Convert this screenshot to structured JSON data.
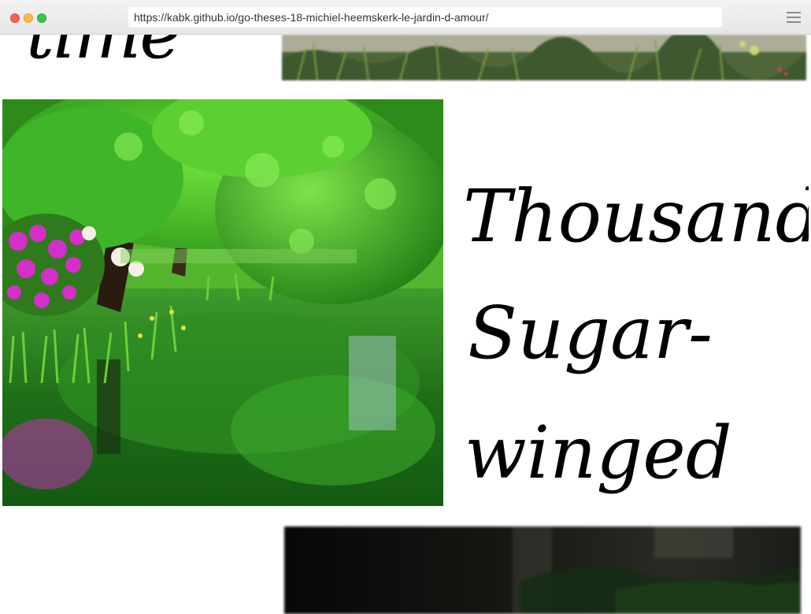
{
  "browser": {
    "url": "https://kabk.github.io/go-theses-18-michiel-heemskerk-le-jardin-d-amour/"
  },
  "page": {
    "top_word": "time",
    "words": [
      "Thousand",
      "Sugar-",
      "winged"
    ]
  },
  "colors": {
    "chrome_bg": "#e8e8e8",
    "text": "#000000",
    "page_bg": "#ffffff"
  },
  "icons": {
    "window_controls": [
      "close-dot",
      "minimize-dot",
      "maximize-dot"
    ],
    "menu": "hamburger-menu-icon"
  }
}
